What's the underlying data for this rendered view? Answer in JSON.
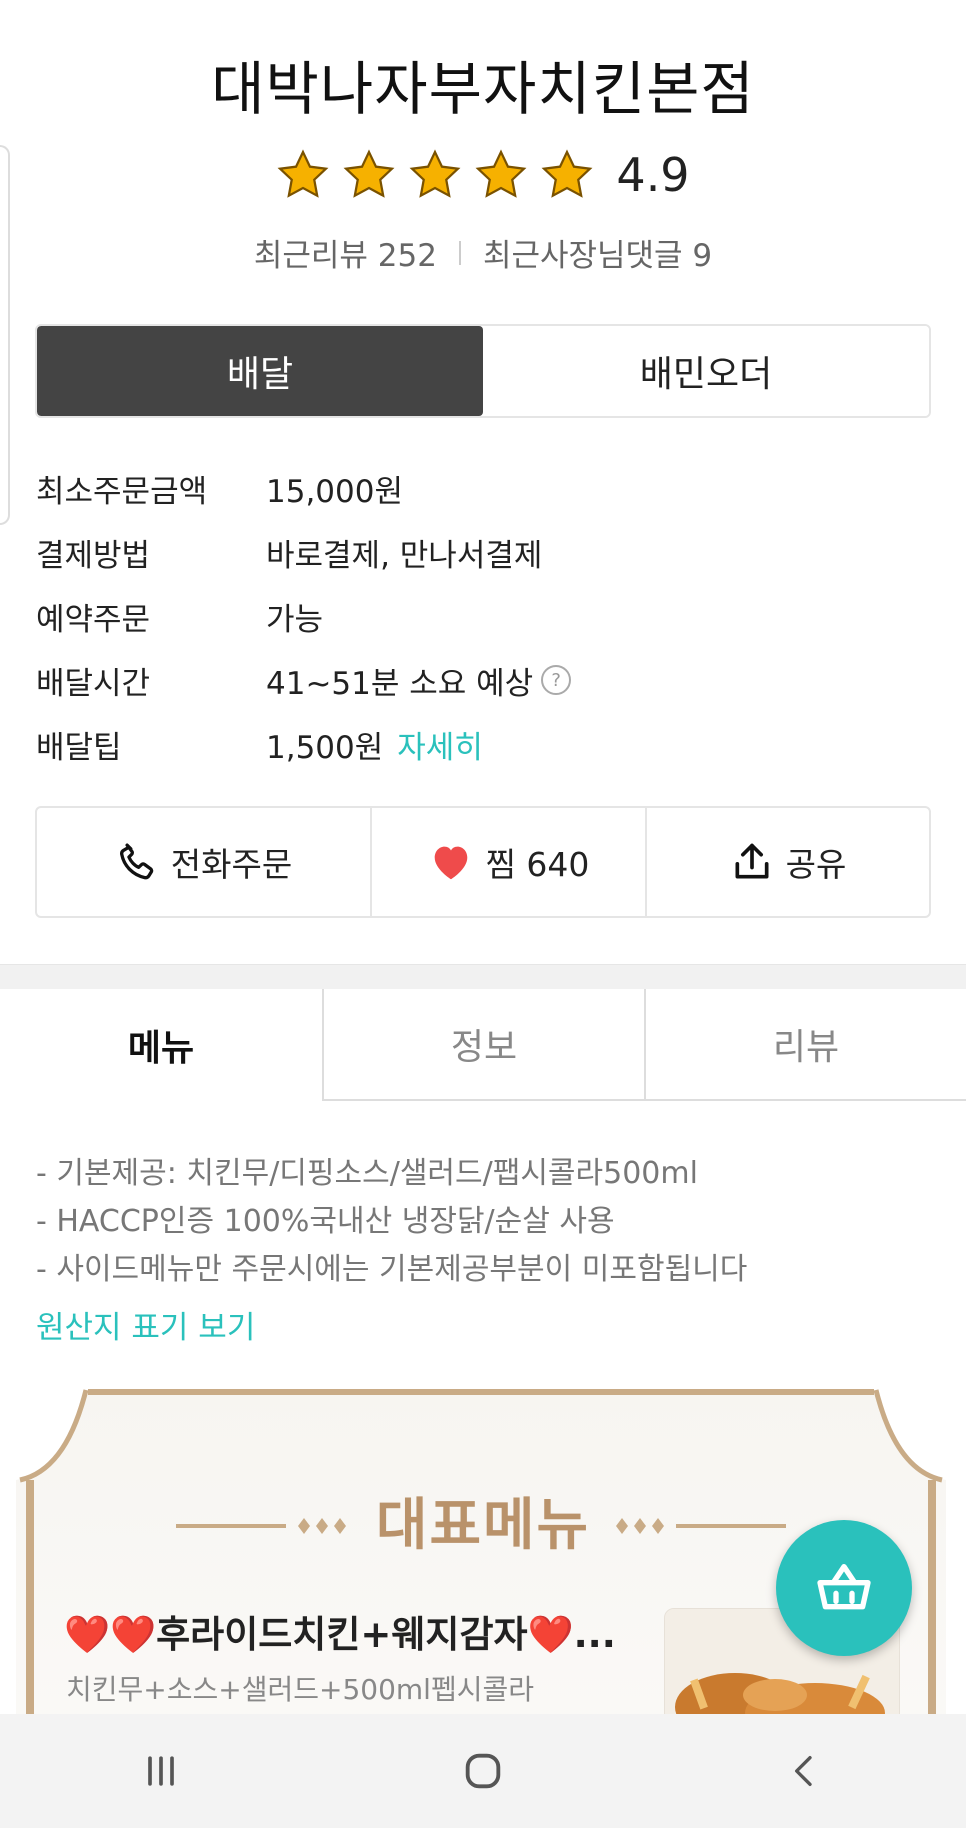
{
  "store": {
    "name": "대박나자부자치킨본점",
    "rating": "4.9",
    "star_count": 5,
    "recent_reviews_label": "최근리뷰 252",
    "recent_owner_replies_label": "최근사장님댓글 9"
  },
  "order_toggle": {
    "delivery_label": "배달",
    "baemin_order_label": "배민오더",
    "selected": "배달"
  },
  "info": {
    "min_order_label": "최소주문금액",
    "min_order_value": "15,000원",
    "payment_label": "결제방법",
    "payment_value": "바로결제, 만나서결제",
    "reservation_label": "예약주문",
    "reservation_value": "가능",
    "delivery_time_label": "배달시간",
    "delivery_time_value": "41~51분 소요 예상",
    "delivery_tip_label": "배달팁",
    "delivery_tip_value": "1,500원",
    "delivery_tip_link": "자세히",
    "help_glyph": "?"
  },
  "actions": {
    "call_label": "전화주문",
    "favorite_label": "찜 640",
    "share_label": "공유"
  },
  "tabs": [
    {
      "label": "메뉴",
      "active": true
    },
    {
      "label": "정보",
      "active": false
    },
    {
      "label": "리뷰",
      "active": false
    }
  ],
  "menu_notice": {
    "line1": "- 기본제공: 치킨무/디핑소스/샐러드/팹시콜라500ml",
    "line2": "- HACCP인증 100%국내산 냉장닭/순살 사용",
    "line3": "- 사이드메뉴만 주문시에는 기본제공부분이 미포함됩니다",
    "origin_link": "원산지 표기 보기"
  },
  "featured": {
    "banner_title": "대표메뉴",
    "item_name": "❤️❤️후라이드치킨+웨지감자❤️...",
    "item_desc": "치킨무+소스+샐러드+500ml펩시콜라"
  },
  "colors": {
    "accent": "#2ac1bc",
    "toggle_active_bg": "#444444",
    "heart": "#ef4b4b",
    "banner_gold": "#b9926a"
  },
  "icons": {
    "call": "phone-icon",
    "favorite": "heart-icon",
    "share": "share-icon",
    "cart": "basket-icon",
    "nav_recents": "recents-icon",
    "nav_home": "home-icon",
    "nav_back": "back-icon"
  }
}
